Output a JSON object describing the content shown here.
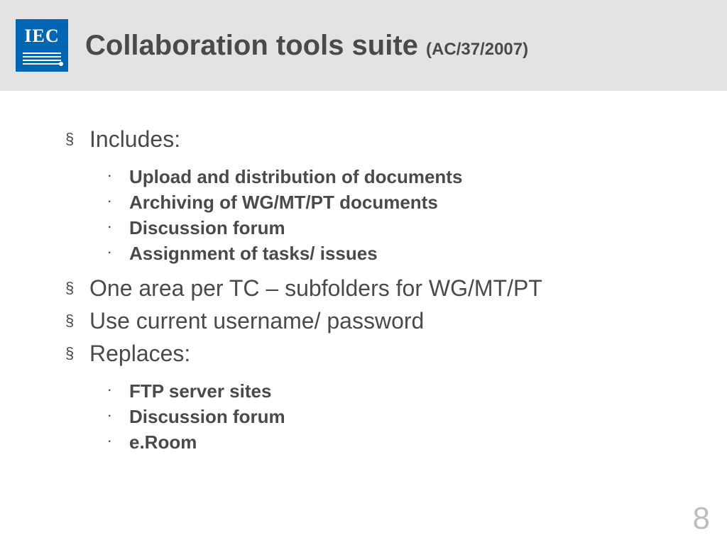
{
  "logo": {
    "text_top": "IEC"
  },
  "header": {
    "title_main": "Collaboration tools suite ",
    "title_sub": "(AC/37/2007)"
  },
  "bullets": {
    "includes_label": "Includes:",
    "includes_items": [
      "Upload and distribution of documents",
      "Archiving of WG/MT/PT documents",
      "Discussion forum",
      "Assignment of tasks/ issues"
    ],
    "one_area": "One area per TC – subfolders for WG/MT/PT",
    "use_current": "Use current username/ password",
    "replaces_label": "Replaces:",
    "replaces_items": [
      "FTP server sites",
      "Discussion forum",
      "e.Room"
    ]
  },
  "page_number": "8"
}
